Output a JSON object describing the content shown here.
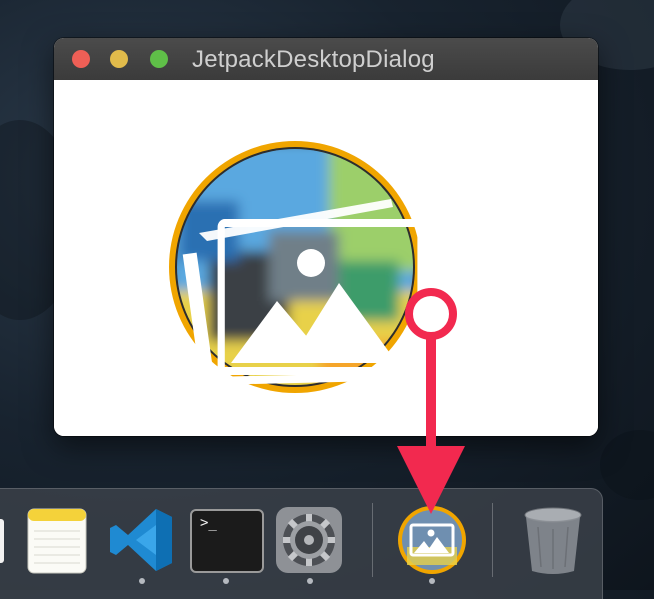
{
  "window": {
    "title": "JetpackDesktopDialog",
    "traffic_lights": {
      "close_color": "#ee5f56",
      "minimize_color": "#e1bb4b",
      "zoom_color": "#5fbf48"
    }
  },
  "app_icon": {
    "icon": "photo-icon",
    "ring_color": "#f0a500"
  },
  "annotation": {
    "color": "#f2294f",
    "icon": "drag-arrow"
  },
  "dock": {
    "items": [
      {
        "name": "notes",
        "icon": "notes-icon",
        "running": false
      },
      {
        "name": "vscode",
        "icon": "vscode-icon",
        "running": true
      },
      {
        "name": "terminal",
        "icon": "terminal-icon",
        "running": true,
        "prompt_text": ">_"
      },
      {
        "name": "system-preferences",
        "icon": "gear-icon",
        "running": true
      },
      {
        "name": "jetpack",
        "icon": "photo-icon",
        "running": true
      },
      {
        "name": "trash",
        "icon": "trash-icon",
        "running": false
      }
    ]
  }
}
